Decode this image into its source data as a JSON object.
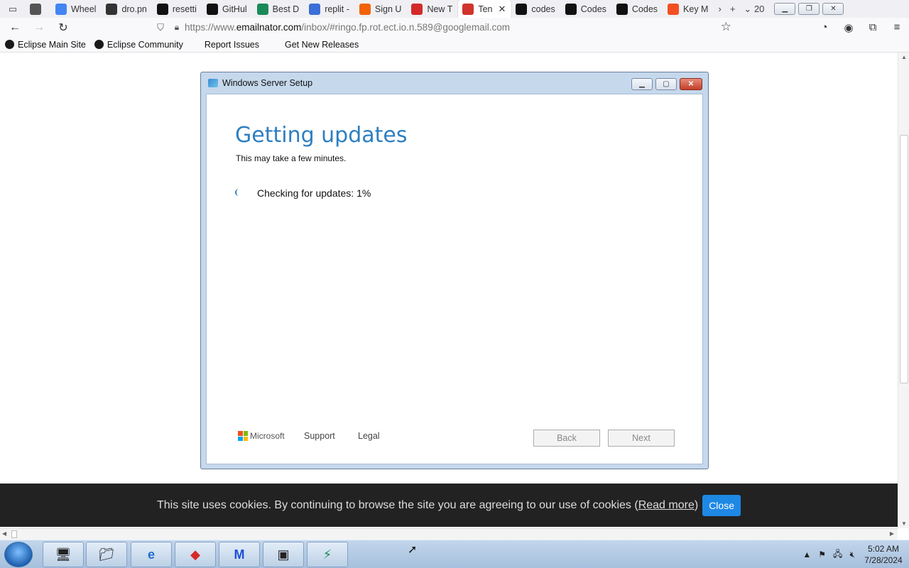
{
  "tabs": [
    {
      "label": "",
      "icon": "back-nav-icon",
      "color": "#555555"
    },
    {
      "label": "Wheel",
      "icon": "google-icon",
      "color": "#4285f4"
    },
    {
      "label": "dro.pn",
      "icon": "terminal-icon",
      "color": "#333333"
    },
    {
      "label": "resetti",
      "icon": "github-icon",
      "color": "#111111"
    },
    {
      "label": "GitHul",
      "icon": "github-icon",
      "color": "#111111"
    },
    {
      "label": "Best D",
      "icon": "green-circle-icon",
      "color": "#1b8a5a"
    },
    {
      "label": "replit -",
      "icon": "search-icon",
      "color": "#3b6fd6"
    },
    {
      "label": "Sign U",
      "icon": "replit-icon",
      "color": "#f26207"
    },
    {
      "label": "New T",
      "icon": "fox-icon",
      "color": "#d42a2a"
    },
    {
      "label": "Ten",
      "icon": "mail-icon",
      "color": "#d0342c",
      "active": true
    },
    {
      "label": "codes",
      "icon": "github-icon",
      "color": "#111111"
    },
    {
      "label": "Codes",
      "icon": "github-icon",
      "color": "#111111"
    },
    {
      "label": "Codes",
      "icon": "github-icon",
      "color": "#111111"
    },
    {
      "label": "Key M",
      "icon": "windows-icon",
      "color": "#f25022"
    }
  ],
  "tab_count": "20",
  "url": {
    "prefix": "https://www.",
    "domain": "emailnator.com",
    "path": "/inbox/#ringo.fp.rot.ect.io.n.589@googlemail.com"
  },
  "bookmarks": [
    {
      "label": "Eclipse Main Site",
      "dot": true
    },
    {
      "label": "Eclipse Community",
      "dot": true
    },
    {
      "label": "Report Issues",
      "dot": false
    },
    {
      "label": "Get New Releases",
      "dot": false
    }
  ],
  "setup": {
    "window_title": "Windows Server Setup",
    "heading": "Getting updates",
    "subheading": "This may take a few minutes.",
    "status": "Checking for updates: 1%",
    "brand": "Microsoft",
    "support_link": "Support",
    "legal_link": "Legal",
    "back_button": "Back",
    "next_button": "Next"
  },
  "cookie": {
    "text": "This site uses cookies. By continuing to browse the site you are agreeing to our use of cookies (",
    "link": "Read more",
    "close_paren": ")",
    "close_button": "Close"
  },
  "clock": {
    "time": "5:02 AM",
    "date": "7/28/2024"
  },
  "colors": {
    "setup_accent": "#2d7fc1",
    "cookie_bg": "#222222",
    "close_button": "#1e88e5"
  }
}
